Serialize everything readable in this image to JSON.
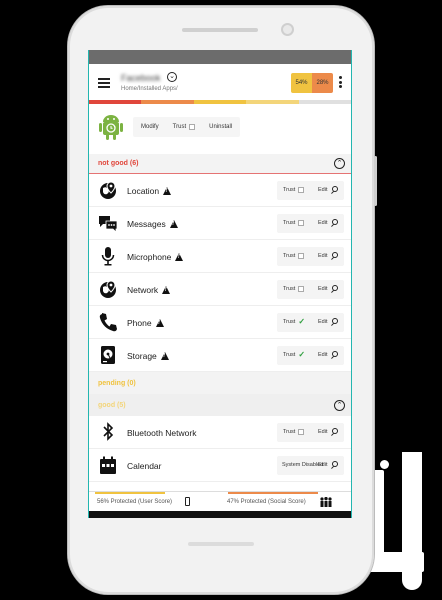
{
  "app": {
    "name": "Facebook",
    "breadcrumb": "Home/Installed Apps/",
    "user_score_badge": "54%",
    "social_score_badge": "28%",
    "actions": {
      "modify": "Modify",
      "trust": "Trust",
      "uninstall": "Uninstall"
    }
  },
  "sections": {
    "not_good": "not good (6)",
    "pending": "pending (0)",
    "good": "good (5)"
  },
  "controls": {
    "trust": "Trust",
    "edit": "Edit",
    "system_disabled": "System Disabled"
  },
  "permissions": [
    {
      "label": "Location",
      "icon": "location-globe-icon",
      "trusted": false
    },
    {
      "label": "Messages",
      "icon": "messages-icon",
      "trusted": false
    },
    {
      "label": "Microphone",
      "icon": "microphone-icon",
      "trusted": false
    },
    {
      "label": "Network",
      "icon": "network-globe-icon",
      "trusted": false
    },
    {
      "label": "Phone",
      "icon": "phone-icon",
      "trusted": true
    },
    {
      "label": "Storage",
      "icon": "storage-icon",
      "trusted": true
    }
  ],
  "good_permissions": [
    {
      "label": "Bluetooth Network",
      "icon": "bluetooth-icon",
      "trusted": false
    },
    {
      "label": "Calendar",
      "icon": "calendar-icon",
      "system_disabled": true
    }
  ],
  "footer": {
    "user_score": "56% Protected (User Score)",
    "social_score": "47% Protected (Social Score)"
  },
  "colors": {
    "accent_teal": "#23b6b0",
    "not_good": "#e0463b",
    "pending": "#f0c340",
    "good": "#f3d57a",
    "user_badge": "#f0c340",
    "social_badge": "#ec8a4a",
    "trusted_check": "#2e9e3e"
  }
}
